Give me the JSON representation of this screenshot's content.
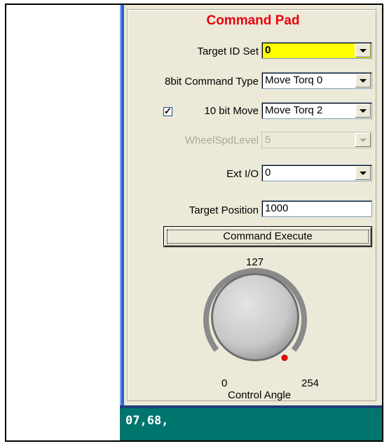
{
  "panel": {
    "title": "Command Pad",
    "target_id": {
      "label": "Target ID Set",
      "value": "0"
    },
    "cmd_type_8bit": {
      "label": "8bit Command Type",
      "value": "Move Torq 0"
    },
    "move_10bit": {
      "label": "10 bit Move",
      "checked": true,
      "check_glyph": "✓",
      "value": "Move Torq 2"
    },
    "wheel_spd": {
      "label": "WheelSpdLevel",
      "value": "5",
      "disabled": true
    },
    "ext_io": {
      "label": "Ext I/O",
      "value": "0"
    },
    "target_position": {
      "label": "Target Position",
      "value": "1000"
    },
    "execute_button": "Command Execute",
    "knob": {
      "max_label": "127",
      "min_label": "0",
      "end_label": "254",
      "caption": "Control Angle",
      "indicator_color": "#ff0000"
    }
  },
  "console": {
    "text": "07,68,"
  },
  "colors": {
    "title": "#e8000b",
    "target_id_bg": "#ffff00",
    "arrow": "#ff0000",
    "console_bg": "#00756d"
  }
}
